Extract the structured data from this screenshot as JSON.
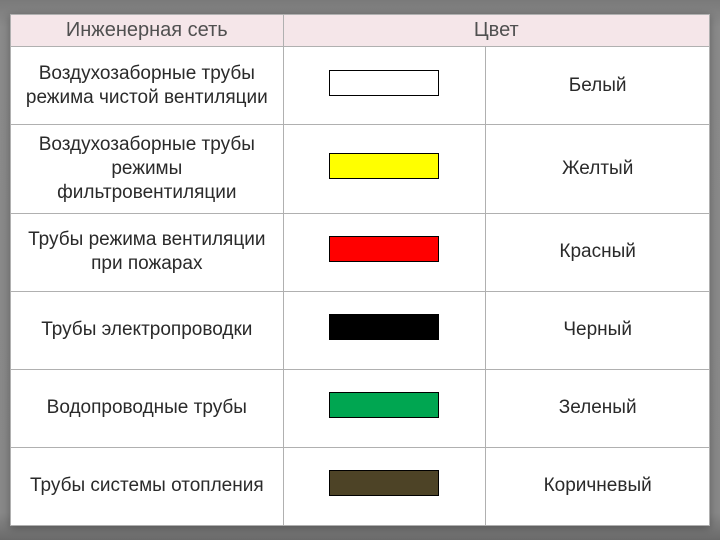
{
  "header": {
    "col1": "Инженерная сеть",
    "col2": "Цвет"
  },
  "rows": [
    {
      "label": "Воздухозаборные трубы режима чистой вентиляции",
      "swatch": "#ffffff",
      "color_name": "Белый"
    },
    {
      "label": "Воздухозаборные трубы режимы фильтровентиляции",
      "swatch": "#ffff00",
      "color_name": "Желтый"
    },
    {
      "label": "Трубы режима вентиляции при пожарах",
      "swatch": "#ff0000",
      "color_name": "Красный"
    },
    {
      "label": "Трубы электропроводки",
      "swatch": "#000000",
      "color_name": "Черный"
    },
    {
      "label": "Водопроводные трубы",
      "swatch": "#00a651",
      "color_name": "Зеленый"
    },
    {
      "label": "Трубы системы отопления",
      "swatch": "#4d4326",
      "color_name": "Коричневый"
    }
  ]
}
